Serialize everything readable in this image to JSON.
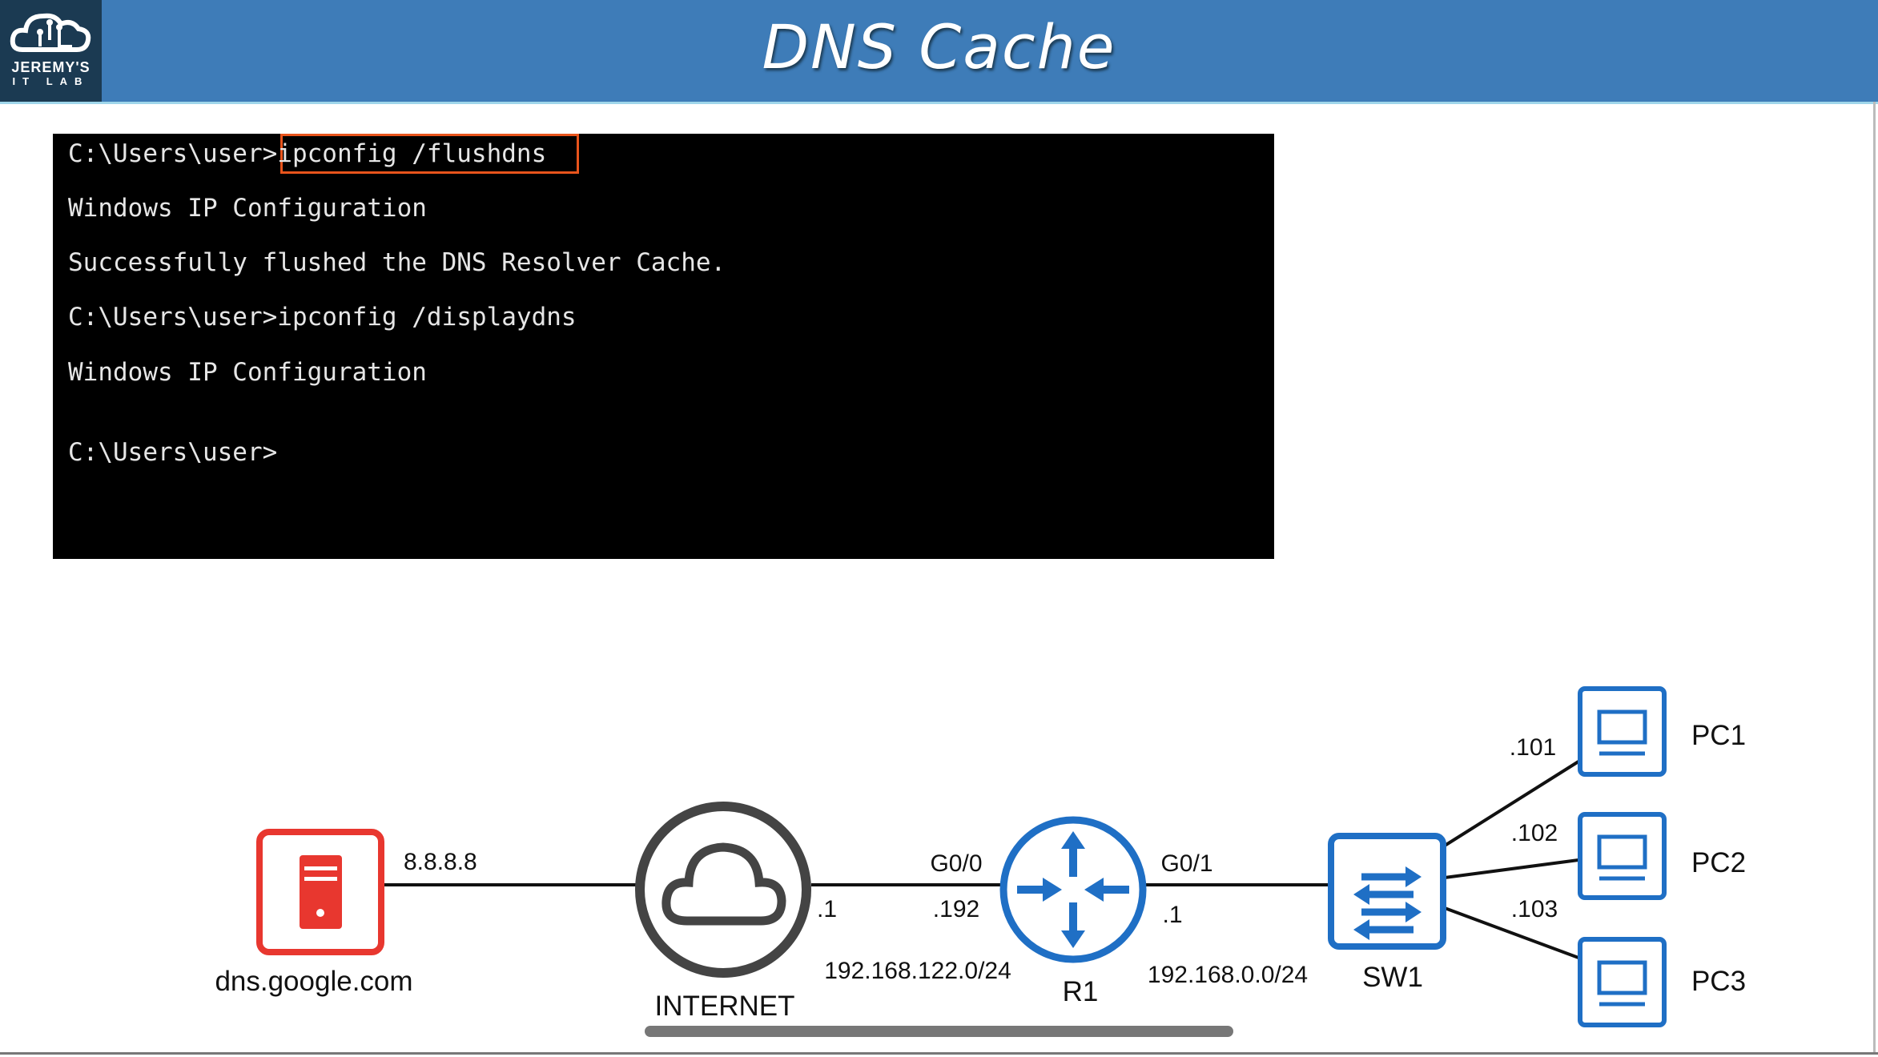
{
  "header": {
    "title": "DNS Cache",
    "logo_line1": "JEREMY'S",
    "logo_line2": "IT LAB"
  },
  "terminal": {
    "lines": [
      "C:\\Users\\user>ipconfig /flushdns",
      "Windows IP Configuration",
      "Successfully flushed the DNS Resolver Cache.",
      "C:\\Users\\user>ipconfig /displaydns",
      "Windows IP Configuration",
      "C:\\Users\\user>"
    ],
    "highlight_color": "#e8541c"
  },
  "diagram": {
    "dns_server": {
      "label": "dns.google.com",
      "ip": "8.8.8.8",
      "color": "#e8372f"
    },
    "internet": {
      "label": "INTERNET",
      "ip": ".1"
    },
    "r1": {
      "label": "R1",
      "g00": "G0/0",
      "g00_ip": ".192",
      "g01": "G0/1",
      "g01_ip": ".1",
      "color": "#1f6fc5"
    },
    "net1": "192.168.122.0/24",
    "net2": "192.168.0.0/24",
    "sw1": {
      "label": "SW1"
    },
    "pcs": [
      {
        "label": "PC1",
        "ip": ".101"
      },
      {
        "label": "PC2",
        "ip": ".102"
      },
      {
        "label": "PC3",
        "ip": ".103"
      }
    ]
  }
}
